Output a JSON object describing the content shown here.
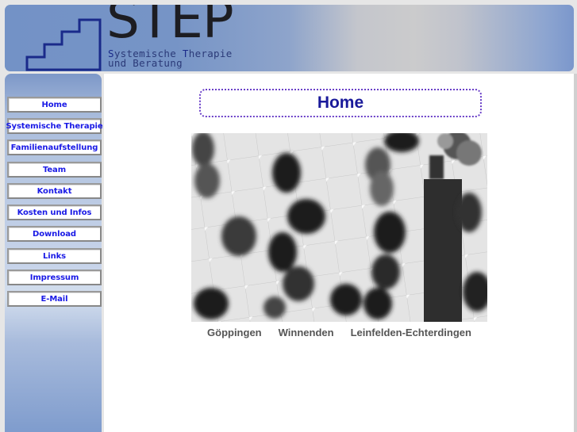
{
  "header": {
    "logo_text": "STEP",
    "logo_sub_line1_s": "S",
    "logo_sub_line1_a": "ystemische ",
    "logo_sub_line1_t": "T",
    "logo_sub_line1_b": "herapie",
    "logo_sub_line2": "und Beratung"
  },
  "sidebar": {
    "items": [
      {
        "label": "Home"
      },
      {
        "label": "Systemische Therapie"
      },
      {
        "label": "Familienaufstellung"
      },
      {
        "label": "Team"
      },
      {
        "label": "Kontakt"
      },
      {
        "label": "Kosten und Infos"
      },
      {
        "label": "Download"
      },
      {
        "label": "Links"
      },
      {
        "label": "Impressum"
      },
      {
        "label": "E-Mail"
      }
    ]
  },
  "main": {
    "title": "Home",
    "photo_alt": "Menschen auf einem gefliesten Platz von oben",
    "locations": [
      "Göppingen",
      "Winnenden",
      "Leinfelden-Echterdingen"
    ]
  },
  "colors": {
    "nav_text": "#1a1ae6",
    "title_text": "#1a1a9a",
    "title_border": "#6a3fc8"
  }
}
